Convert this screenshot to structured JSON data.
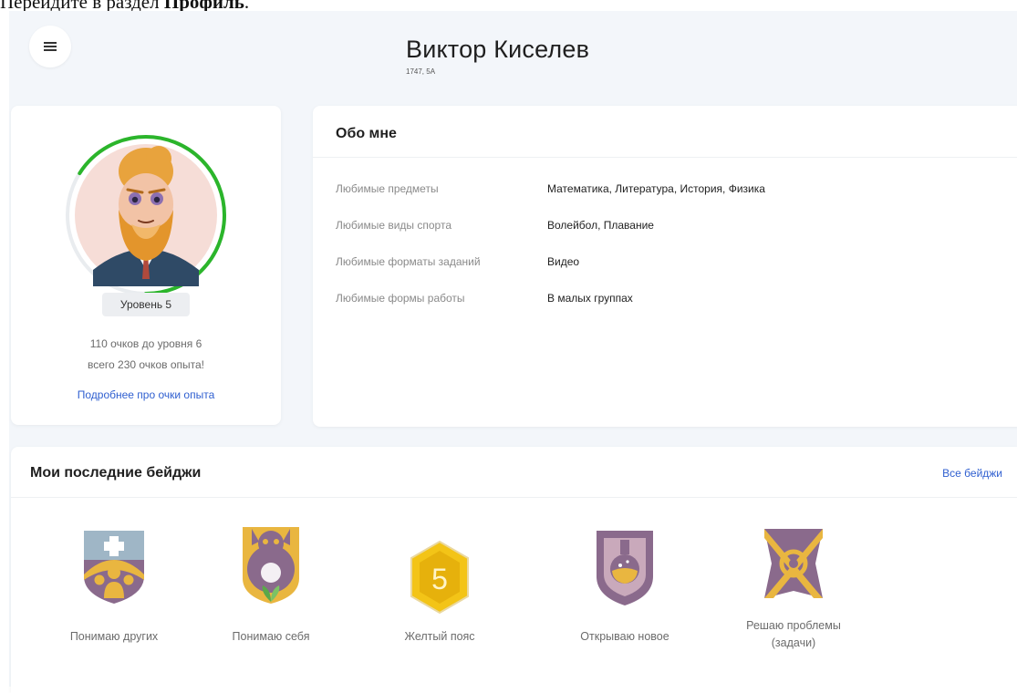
{
  "instruction": {
    "prefix": "Перейдите в раздел ",
    "bold": "Профиль",
    "suffix": "."
  },
  "header": {
    "menu_icon": "hamburger-menu-icon",
    "name": "Виктор Киселев",
    "sub": "1747, 5А"
  },
  "level_card": {
    "level_label": "Уровень 5",
    "points_line1": "110 очков до уровня 6",
    "points_line2": "всего 230 очков опыта!",
    "more_link": "Подробнее про очки опыта",
    "progress_fraction": 0.66,
    "progress_color": "#2bb52b"
  },
  "about": {
    "title": "Обо мне",
    "rows": [
      {
        "key": "Любимые предметы",
        "value": "Математика, Литература, История, Физика"
      },
      {
        "key": "Любимые виды спорта",
        "value": "Волейбол, Плавание"
      },
      {
        "key": "Любимые форматы заданий",
        "value": "Видео"
      },
      {
        "key": "Любимые формы работы",
        "value": "В малых группах"
      }
    ]
  },
  "badges": {
    "title": "Мои последние бейджи",
    "all_link": "Все бейджи",
    "items": [
      {
        "label": "Понимаю других",
        "icon": "understand-others-badge-icon"
      },
      {
        "label": "Понимаю себя",
        "icon": "understand-self-badge-icon"
      },
      {
        "label": "Желтый пояс",
        "icon": "yellow-belt-badge-icon",
        "number": "5"
      },
      {
        "label": "Открываю новое",
        "icon": "discover-new-badge-icon"
      },
      {
        "label": "Решаю проблемы",
        "label2": "(задачи)",
        "icon": "problem-solving-badge-icon"
      }
    ]
  },
  "colors": {
    "accent_link": "#2f5fd0",
    "badge_purple": "#8a6a8c",
    "badge_gold": "#e9b640",
    "progress": "#2bb52b",
    "background": "#f3f6fa"
  }
}
